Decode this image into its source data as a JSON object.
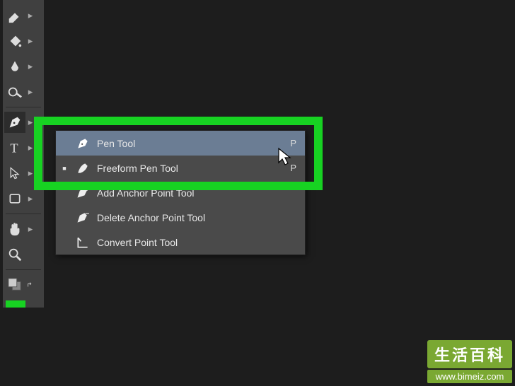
{
  "flyout": {
    "items": [
      {
        "label": "Pen Tool",
        "shortcut": "P",
        "icon": "pen-icon",
        "selected": true,
        "indicator": ""
      },
      {
        "label": "Freeform Pen Tool",
        "shortcut": "P",
        "icon": "freeform-pen-icon",
        "selected": false,
        "indicator": "■"
      },
      {
        "label": "Add Anchor Point Tool",
        "shortcut": "",
        "icon": "add-anchor-icon",
        "selected": false,
        "indicator": ""
      },
      {
        "label": "Delete Anchor Point Tool",
        "shortcut": "",
        "icon": "delete-anchor-icon",
        "selected": false,
        "indicator": ""
      },
      {
        "label": "Convert Point Tool",
        "shortcut": "",
        "icon": "convert-point-icon",
        "selected": false,
        "indicator": ""
      }
    ]
  },
  "watermark": {
    "title": "生活百科",
    "url": "www.bimeiz.com"
  }
}
